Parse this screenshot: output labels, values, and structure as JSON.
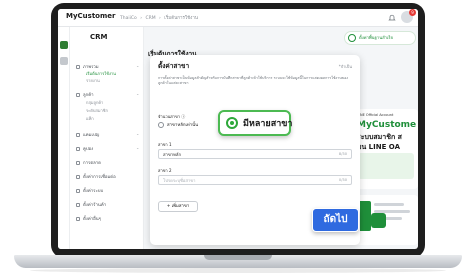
{
  "app": {
    "brand": "MyCustomer",
    "breadcrumb": [
      "ThaiiCo",
      "›",
      "CRM",
      "›",
      "เริ่มต้นการใช้งาน"
    ],
    "notification_count": "9"
  },
  "sidebar": {
    "title": "CRM",
    "items": [
      {
        "label": "ภาพรวม"
      },
      {
        "label": "เริ่มต้นการใช้งาน"
      },
      {
        "label": "รายงาน"
      },
      {
        "label": "ลูกค้า"
      },
      {
        "label": "กลุ่มลูกค้า"
      },
      {
        "label": "ระดับสมาชิก"
      },
      {
        "label": "แท็ก"
      },
      {
        "label": "แคมเปญ"
      },
      {
        "label": "คูปอง"
      },
      {
        "label": "การตลาด"
      },
      {
        "label": "ตั้งค่าการเชื่อมต่อ"
      },
      {
        "label": "ตั้งค่าระบบ"
      },
      {
        "label": "ตั้งค่าร้านค้า"
      },
      {
        "label": "ตั้งค่าอื่นๆ"
      }
    ]
  },
  "main": {
    "title": "เริ่มต้นการใช้งาน",
    "setup_pill": "ตั้งค่าพื้นฐานสำเร็จ"
  },
  "promo": {
    "tag": "LINE Official Account",
    "line1": "MyCustome",
    "line2": "ระบบสมาชิก ส",
    "line3": "บน LINE OA"
  },
  "modal": {
    "title": "ตั้งค่าสาขา",
    "required_note": "*จำเป็น",
    "description": "การตั้งค่าสาขาเป็นข้อมูลสำคัญสำหรับการบันทึกสาขาที่ลูกค้าเข้าใช้บริการ ระบบจะใช้ข้อมูลนี้ในการแสดงผลการใช้งานของลูกค้าในแต่ละสาขา",
    "branch_count_label": "จำนวนสาขา ⓘ",
    "option_single": "สาขาหลักเท่านั้น",
    "option_multi": "มีหลายสาขา",
    "branch1_label": "สาขา 1",
    "branch1_value": "สาขาหลัก",
    "branch1_count": "8/30",
    "branch2_label": "สาขา 2",
    "branch2_placeholder": "โปรดระบุชื่อสาขา",
    "branch2_count": "0/30",
    "add_branch": "+ เพิ่มสาขา"
  },
  "next_button": "ถัดไป"
}
